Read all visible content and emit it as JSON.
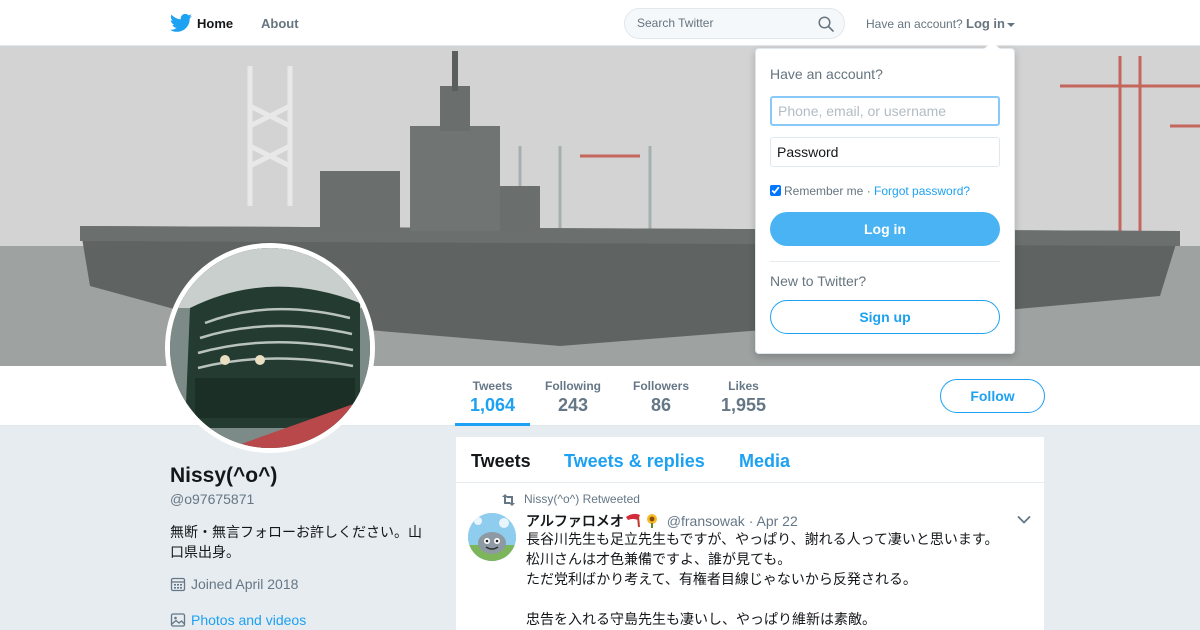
{
  "nav": {
    "home": "Home",
    "about": "About",
    "search_placeholder": "Search Twitter",
    "have_account": "Have an account?",
    "login": "Log in"
  },
  "profile": {
    "fullname": "Nissy(^o^)",
    "screenname": "@o97675871",
    "bio": "無断・無言フォローお許しください。山口県出身。",
    "joined": "Joined April 2018",
    "photos": "Photos and videos",
    "follow": "Follow"
  },
  "stats": [
    {
      "label": "Tweets",
      "value": "1,064"
    },
    {
      "label": "Following",
      "value": "243"
    },
    {
      "label": "Followers",
      "value": "86"
    },
    {
      "label": "Likes",
      "value": "1,955"
    }
  ],
  "timeline": {
    "tabs": [
      "Tweets",
      "Tweets & replies",
      "Media"
    ],
    "tweet": {
      "retweeted_by": "Nissy(^o^) Retweeted",
      "name": "アルファロメオ",
      "handle": "@fransowak",
      "date": "Apr 22",
      "text": "長谷川先生も足立先生もですが、やっぱり、謝れる人って凄いと思います。\n松川さんは才色兼備ですよ、誰が見ても。\nただ党利ばかり考えて、有権者目線じゃないから反発される。\n\n忠告を入れる守島先生も凄いし、やっぱり維新は素敵。"
    }
  },
  "login_dropdown": {
    "title": "Have an account?",
    "username_placeholder": "Phone, email, or username",
    "password_placeholder": "Password",
    "remember": "Remember me",
    "separator": " · ",
    "forgot": "Forgot password?",
    "login_button": "Log in",
    "new_to": "New to Twitter?",
    "signup": "Sign up"
  },
  "colors": {
    "accent": "#1da1f2",
    "login_button": "#4ab3f4",
    "background": "#e6ecf0"
  }
}
